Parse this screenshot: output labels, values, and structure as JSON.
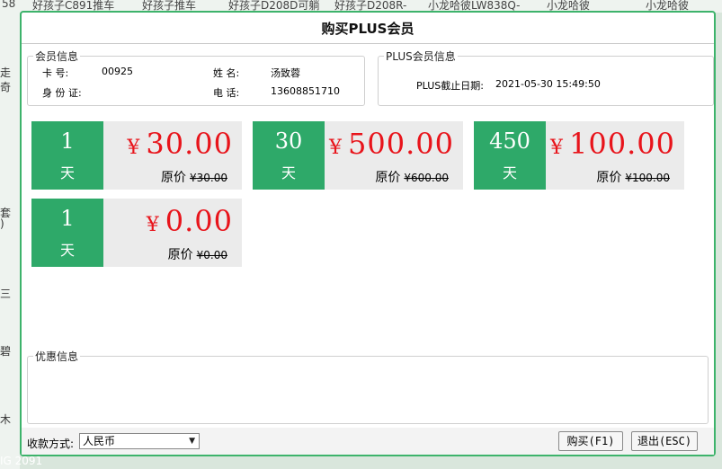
{
  "background": {
    "top_tabs": [
      "58",
      "好孩子C891推车",
      "好孩子推车",
      "好孩子D208D可躺",
      "好孩子D208R-",
      "小龙哈彼LW838Q-",
      "小龙哈彼",
      "小龙哈彼"
    ],
    "left_items": [
      "走",
      "奇",
      "套",
      ")",
      "三",
      "碧",
      "木"
    ],
    "bottom_text": "IG  2091"
  },
  "dialog": {
    "title": "购买PLUS会员",
    "member_info": {
      "legend": "会员信息",
      "card_label": "卡    号:",
      "card_value": "00925",
      "id_label": "身 份 证:",
      "id_value": "",
      "name_label": "姓    名:",
      "name_value": "汤致蓉",
      "phone_label": "电    话:",
      "phone_value": "13608851710"
    },
    "plus_info": {
      "legend": "PLUS会员信息",
      "expiry_label": "PLUS截止日期:",
      "expiry_value": "2021-05-30 15:49:50"
    },
    "plans": [
      {
        "days": "1",
        "unit": "天",
        "currency": "¥",
        "price": "30.00",
        "orig_label": "原价",
        "orig_price": "¥30.00"
      },
      {
        "days": "30",
        "unit": "天",
        "currency": "¥",
        "price": "500.00",
        "orig_label": "原价",
        "orig_price": "¥600.00"
      },
      {
        "days": "450",
        "unit": "天",
        "currency": "¥",
        "price": "100.00",
        "orig_label": "原价",
        "orig_price": "¥100.00"
      },
      {
        "days": "1",
        "unit": "天",
        "currency": "¥",
        "price": "0.00",
        "orig_label": "原价",
        "orig_price": "¥0.00"
      }
    ],
    "promo": {
      "legend": "优惠信息",
      "content": ""
    },
    "footer": {
      "payment_label": "收款方式:",
      "payment_selected": "人民币",
      "buy_button": "购买(F1)",
      "exit_button": "退出(ESC)"
    }
  },
  "colors": {
    "accent": "#2ea969",
    "price": "#e8141b",
    "border": "#3db36b"
  }
}
